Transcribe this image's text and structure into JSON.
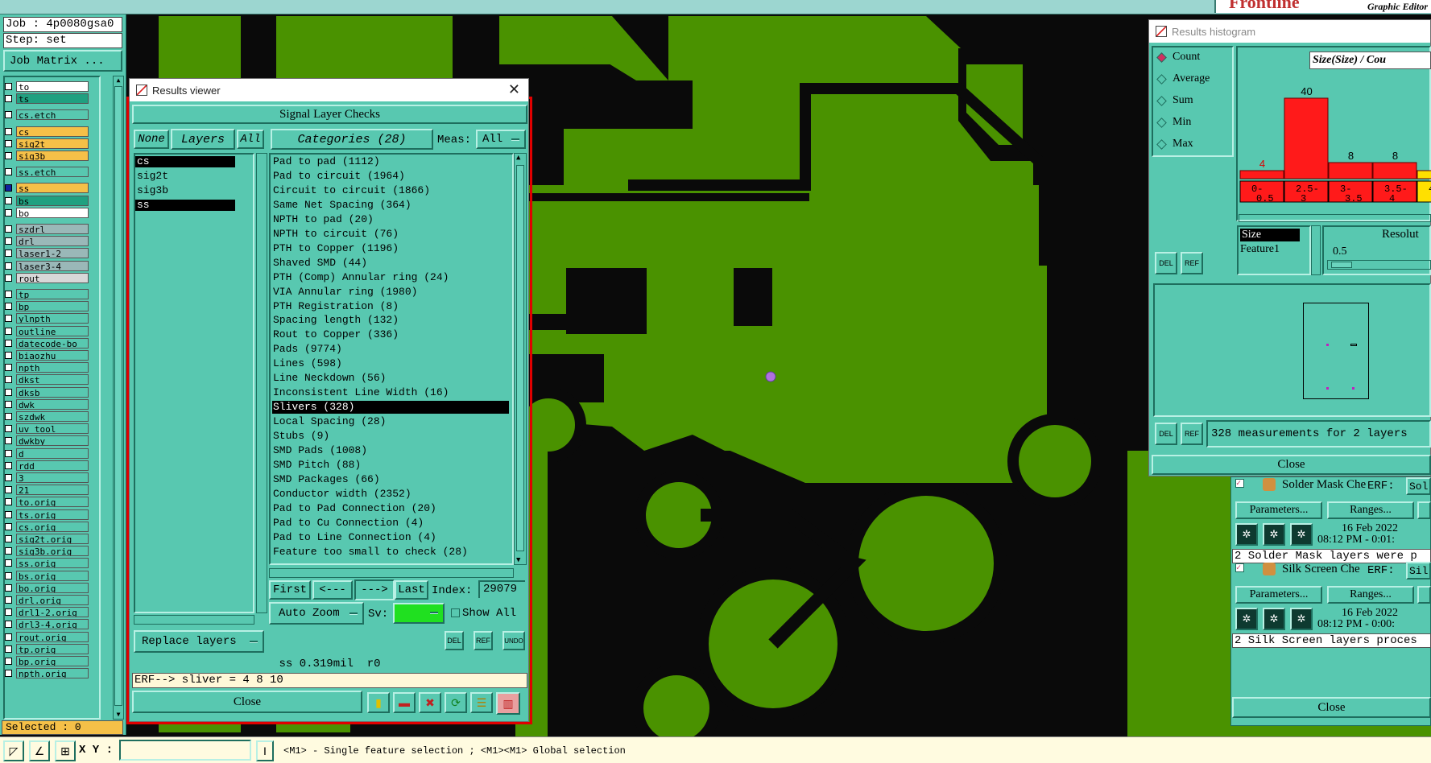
{
  "app": {
    "brand": "Frontline",
    "brand_sub": "Graphic Editor"
  },
  "job_panel": {
    "job_label": "Job : 4p0080gsa0",
    "step_label": "Step: set",
    "job_matrix_btn": "Job Matrix ...",
    "layers": [
      {
        "name": "to",
        "color": "#ffffff"
      },
      {
        "name": "ts",
        "color": "#20a080"
      },
      {
        "name": "cs.etch",
        "color": "#58c8b0"
      },
      {
        "name": "cs",
        "color": "#f5c048"
      },
      {
        "name": "sig2t",
        "color": "#f5c048"
      },
      {
        "name": "sig3b",
        "color": "#f5c048"
      },
      {
        "name": "ss.etch",
        "color": "#58c8b0"
      },
      {
        "name": "ss",
        "color": "#f5c048"
      },
      {
        "name": "bs",
        "color": "#20a080"
      },
      {
        "name": "bo",
        "color": "#ffffff"
      },
      {
        "name": "szdrl",
        "color": "#9ab8b8"
      },
      {
        "name": "drl",
        "color": "#9ab8b8"
      },
      {
        "name": "laser1-2",
        "color": "#9ab8b8"
      },
      {
        "name": "laser3-4",
        "color": "#9ab8b8"
      },
      {
        "name": "rout",
        "color": "#d8d8d8"
      },
      {
        "name": "tp",
        "color": "#58c8b0"
      },
      {
        "name": "bp",
        "color": "#58c8b0"
      },
      {
        "name": "ylnpth",
        "color": "#58c8b0"
      },
      {
        "name": "outline",
        "color": "#58c8b0"
      },
      {
        "name": "datecode-bo",
        "color": "#58c8b0"
      },
      {
        "name": "biaozhu",
        "color": "#58c8b0"
      },
      {
        "name": "npth",
        "color": "#58c8b0"
      },
      {
        "name": "dkst",
        "color": "#58c8b0"
      },
      {
        "name": "dksb",
        "color": "#58c8b0"
      },
      {
        "name": "dwk",
        "color": "#58c8b0"
      },
      {
        "name": "szdwk",
        "color": "#58c8b0"
      },
      {
        "name": "uv_tool",
        "color": "#58c8b0"
      },
      {
        "name": "dwkby",
        "color": "#58c8b0"
      },
      {
        "name": "d",
        "color": "#58c8b0"
      },
      {
        "name": "rdd",
        "color": "#58c8b0"
      },
      {
        "name": "3",
        "color": "#58c8b0"
      },
      {
        "name": "21",
        "color": "#58c8b0"
      },
      {
        "name": "to.orig",
        "color": "#58c8b0"
      },
      {
        "name": "ts.orig",
        "color": "#58c8b0"
      },
      {
        "name": "cs.orig",
        "color": "#58c8b0"
      },
      {
        "name": "sig2t.orig",
        "color": "#58c8b0"
      },
      {
        "name": "sig3b.orig",
        "color": "#58c8b0"
      },
      {
        "name": "ss.orig",
        "color": "#58c8b0"
      },
      {
        "name": "bs.orig",
        "color": "#58c8b0"
      },
      {
        "name": "bo.orig",
        "color": "#58c8b0"
      },
      {
        "name": "drl.orig",
        "color": "#58c8b0"
      },
      {
        "name": "drl1-2.orig",
        "color": "#58c8b0"
      },
      {
        "name": "drl3-4.orig",
        "color": "#58c8b0"
      },
      {
        "name": "rout.orig",
        "color": "#58c8b0"
      },
      {
        "name": "tp.orig",
        "color": "#58c8b0"
      },
      {
        "name": "bp.orig",
        "color": "#58c8b0"
      },
      {
        "name": "npth.orig",
        "color": "#58c8b0"
      }
    ],
    "selected_label": "Selected : 0"
  },
  "results_viewer": {
    "title": "Results viewer",
    "header": "Signal Layer Checks",
    "none_btn": "None",
    "layers_btn": "Layers",
    "all_btn": "All",
    "categories_btn": "Categories (28)",
    "meas_label": "Meas:",
    "meas_value": "All",
    "layers": [
      "cs",
      "sig2t",
      "sig3b",
      "ss"
    ],
    "categories": [
      "Pad to pad (1112)",
      "Pad to circuit (1964)",
      "Circuit to circuit (1866)",
      "Same Net Spacing (364)",
      "NPTH to pad (20)",
      "NPTH to circuit (76)",
      "PTH to Copper (1196)",
      "Shaved SMD (44)",
      "PTH (Comp) Annular ring (24)",
      "VIA Annular ring (1980)",
      "PTH Registration (8)",
      "Spacing length (132)",
      "Rout to Copper (336)",
      "Pads (9774)",
      "Lines (598)",
      "Line Neckdown (56)",
      "Inconsistent Line Width (16)",
      "Slivers (328)",
      "Local Spacing (28)",
      "Stubs (9)",
      "SMD Pads (1008)",
      "SMD Pitch (88)",
      "SMD Packages (66)",
      "Conductor width (2352)",
      "Pad to Pad Connection (20)",
      "Pad to Cu Connection (4)",
      "Pad to Line Connection (4)",
      "Feature too small to check (28)"
    ],
    "selected_category": "Slivers (328)",
    "first_btn": "First",
    "prev_btn": "<---",
    "next_btn": "--->",
    "last_btn": "Last",
    "index_label": "Index:",
    "index_value": "29079",
    "auto_zoom": "Auto Zoom",
    "sv_label": "Sv:",
    "show_all": "Show All",
    "replace_layers": "Replace layers",
    "del_label": "DEL",
    "ref_label": "REF",
    "undo_label": "UNDO",
    "status_line": "ss 0.319mil  r0",
    "erf_line": "ERF--> sliver = 4 8 10",
    "close_btn": "Close"
  },
  "histogram": {
    "title": "Results histogram",
    "modes": [
      "Count",
      "Average",
      "Sum",
      "Min",
      "Max"
    ],
    "selected_mode": "Count",
    "chart_title": "Size(Size) / Cou",
    "size_item": "Size",
    "feature_item": "Feature1",
    "resolution_label": "Resolut",
    "resolution_value": "0.5",
    "del_label": "DEL",
    "ref_label": "REF",
    "measurements_text": "328 measurements for 2 layers",
    "close_btn": "Close"
  },
  "chart_data": {
    "type": "bar",
    "title": "Size(Size) / Cou",
    "categories": [
      "0-0.5",
      "2.5-3",
      "3-3.5",
      "3.5-4",
      ""
    ],
    "values": [
      4,
      40,
      8,
      8,
      4
    ],
    "labels": [
      "4",
      "40",
      "8",
      "8",
      "4"
    ],
    "ylim": [
      0,
      48
    ],
    "bar_color": "#ff1a1a"
  },
  "checks_panel": {
    "items": [
      {
        "name": "Solder Mask Che",
        "erf_label": "ERF:",
        "erf_value": "Sol",
        "params_btn": "Parameters...",
        "ranges_btn": "Ranges...",
        "date": "16 Feb 2022",
        "time": "08:12 PM - 0:01:",
        "message": "2 Solder Mask layers were p"
      },
      {
        "name": "Silk Screen Che",
        "erf_label": "ERF:",
        "erf_value": "Sil",
        "params_btn": "Parameters...",
        "ranges_btn": "Ranges...",
        "date": "16 Feb 2022",
        "time": "08:12 PM - 0:00:",
        "message": "2 Silk Screen layers proces"
      }
    ],
    "close_btn": "Close"
  },
  "bottom_bar": {
    "xy_label": "X Y :",
    "xy_value": "",
    "hint": "<M1> - Single feature selection ; <M1><M1> Global selection"
  },
  "colors": {
    "panel": "#58c8b0",
    "copper": "#4a9200",
    "highlight_border": "#e00000",
    "marker": "#b070e0"
  }
}
